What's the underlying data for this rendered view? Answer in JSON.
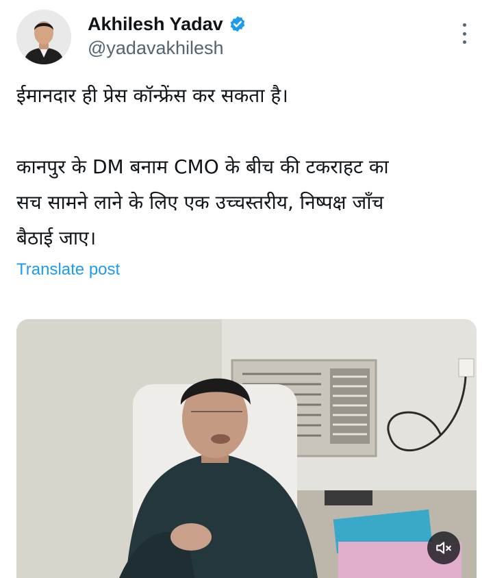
{
  "author": {
    "display_name": "Akhilesh Yadav",
    "handle": "@yadavakhilesh",
    "verified": true
  },
  "post": {
    "line1": "ईमानदार ही प्रेस कॉन्फ्रेंस कर सकता है।",
    "line2": "कानपुर के DM बनाम CMO के बीच की टकराहट का",
    "line3": "सच सामने लाने के लिए एक उच्चस्तरीय, निष्पक्ष जाँच",
    "line4": "बैठाई जाए।"
  },
  "translate_label": "Translate post",
  "media": {
    "type": "video",
    "muted": true,
    "icons": {
      "mute": "speaker-muted-icon",
      "more": "more-options-icon",
      "verified": "verified-badge-icon"
    }
  },
  "colors": {
    "accent": "#1d9bf0",
    "text": "#0f1419",
    "secondary": "#536471"
  }
}
